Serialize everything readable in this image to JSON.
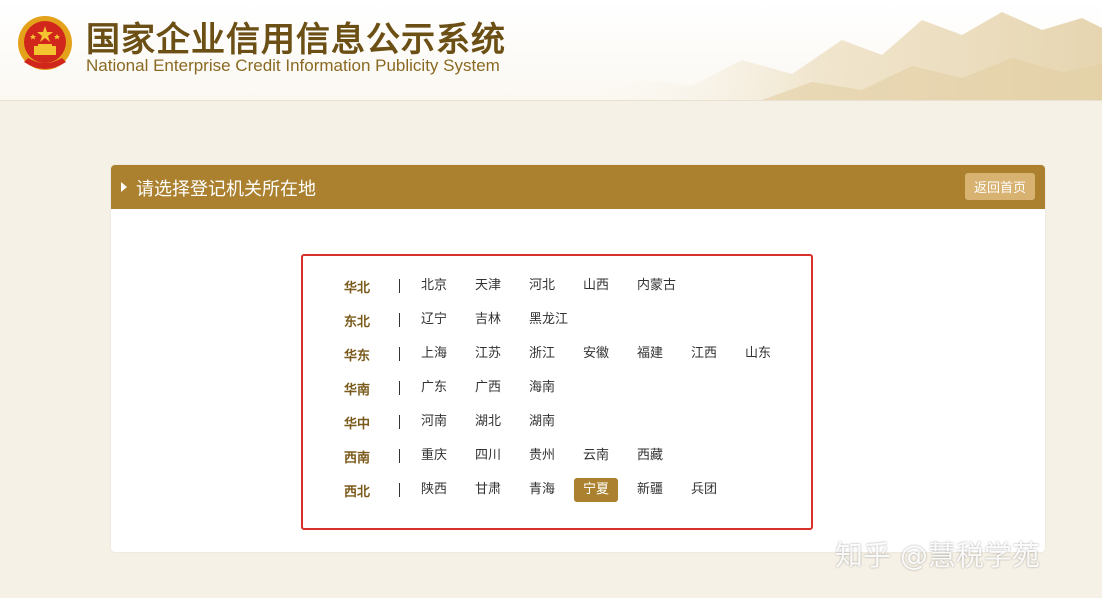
{
  "header": {
    "title": "国家企业信用信息公示系统",
    "subtitle": "National Enterprise Credit Information Publicity System"
  },
  "panel": {
    "title": "请选择登记机关所在地",
    "home_button": "返回首页"
  },
  "regions": [
    {
      "name": "华北",
      "provinces": [
        "北京",
        "天津",
        "河北",
        "山西",
        "内蒙古"
      ]
    },
    {
      "name": "东北",
      "provinces": [
        "辽宁",
        "吉林",
        "黑龙江"
      ]
    },
    {
      "name": "华东",
      "provinces": [
        "上海",
        "江苏",
        "浙江",
        "安徽",
        "福建",
        "江西",
        "山东"
      ]
    },
    {
      "name": "华南",
      "provinces": [
        "广东",
        "广西",
        "海南"
      ]
    },
    {
      "name": "华中",
      "provinces": [
        "河南",
        "湖北",
        "湖南"
      ]
    },
    {
      "name": "西南",
      "provinces": [
        "重庆",
        "四川",
        "贵州",
        "云南",
        "西藏"
      ]
    },
    {
      "name": "西北",
      "provinces": [
        "陕西",
        "甘肃",
        "青海",
        "宁夏",
        "新疆",
        "兵团"
      ]
    }
  ],
  "selected_province": "宁夏",
  "watermark": "知乎 @慧税学苑",
  "colors": {
    "bar": "#ab812f",
    "highlight_border": "#d9302a",
    "title_text": "#6b4f14"
  }
}
